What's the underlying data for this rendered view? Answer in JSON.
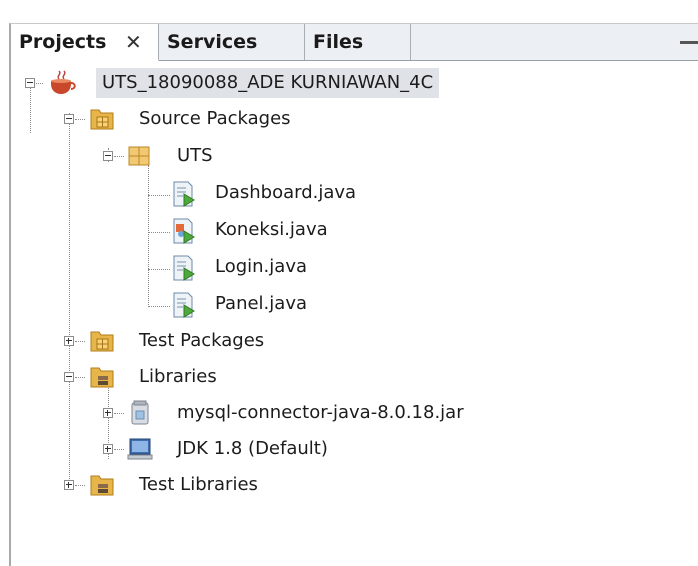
{
  "tabs": [
    {
      "label": "Projects",
      "active": true,
      "closable": true
    },
    {
      "label": "Services",
      "active": false
    },
    {
      "label": "Files",
      "active": false
    }
  ],
  "tree": {
    "project": "UTS_18090088_ADE KURNIAWAN_4C",
    "source_packages": "Source Packages",
    "package": "UTS",
    "files": [
      "Dashboard.java",
      "Koneksi.java",
      "Login.java",
      "Panel.java"
    ],
    "test_packages": "Test Packages",
    "libraries": "Libraries",
    "libs": [
      "mysql-connector-java-8.0.18.jar",
      "JDK 1.8 (Default)"
    ],
    "test_libraries": "Test Libraries"
  },
  "icons": {
    "close": "close-icon",
    "minimize": "minimize-icon",
    "project": "coffee-cup-icon",
    "folder": "package-folder-icon",
    "package": "package-icon",
    "java": "java-file-icon",
    "jar": "jar-icon",
    "jdk": "jdk-icon"
  },
  "colors": {
    "tabbar_bg": "#eceff3",
    "selection_bg": "#dfe3e8",
    "folder": "#e8b54a",
    "package": "#f2c872"
  }
}
